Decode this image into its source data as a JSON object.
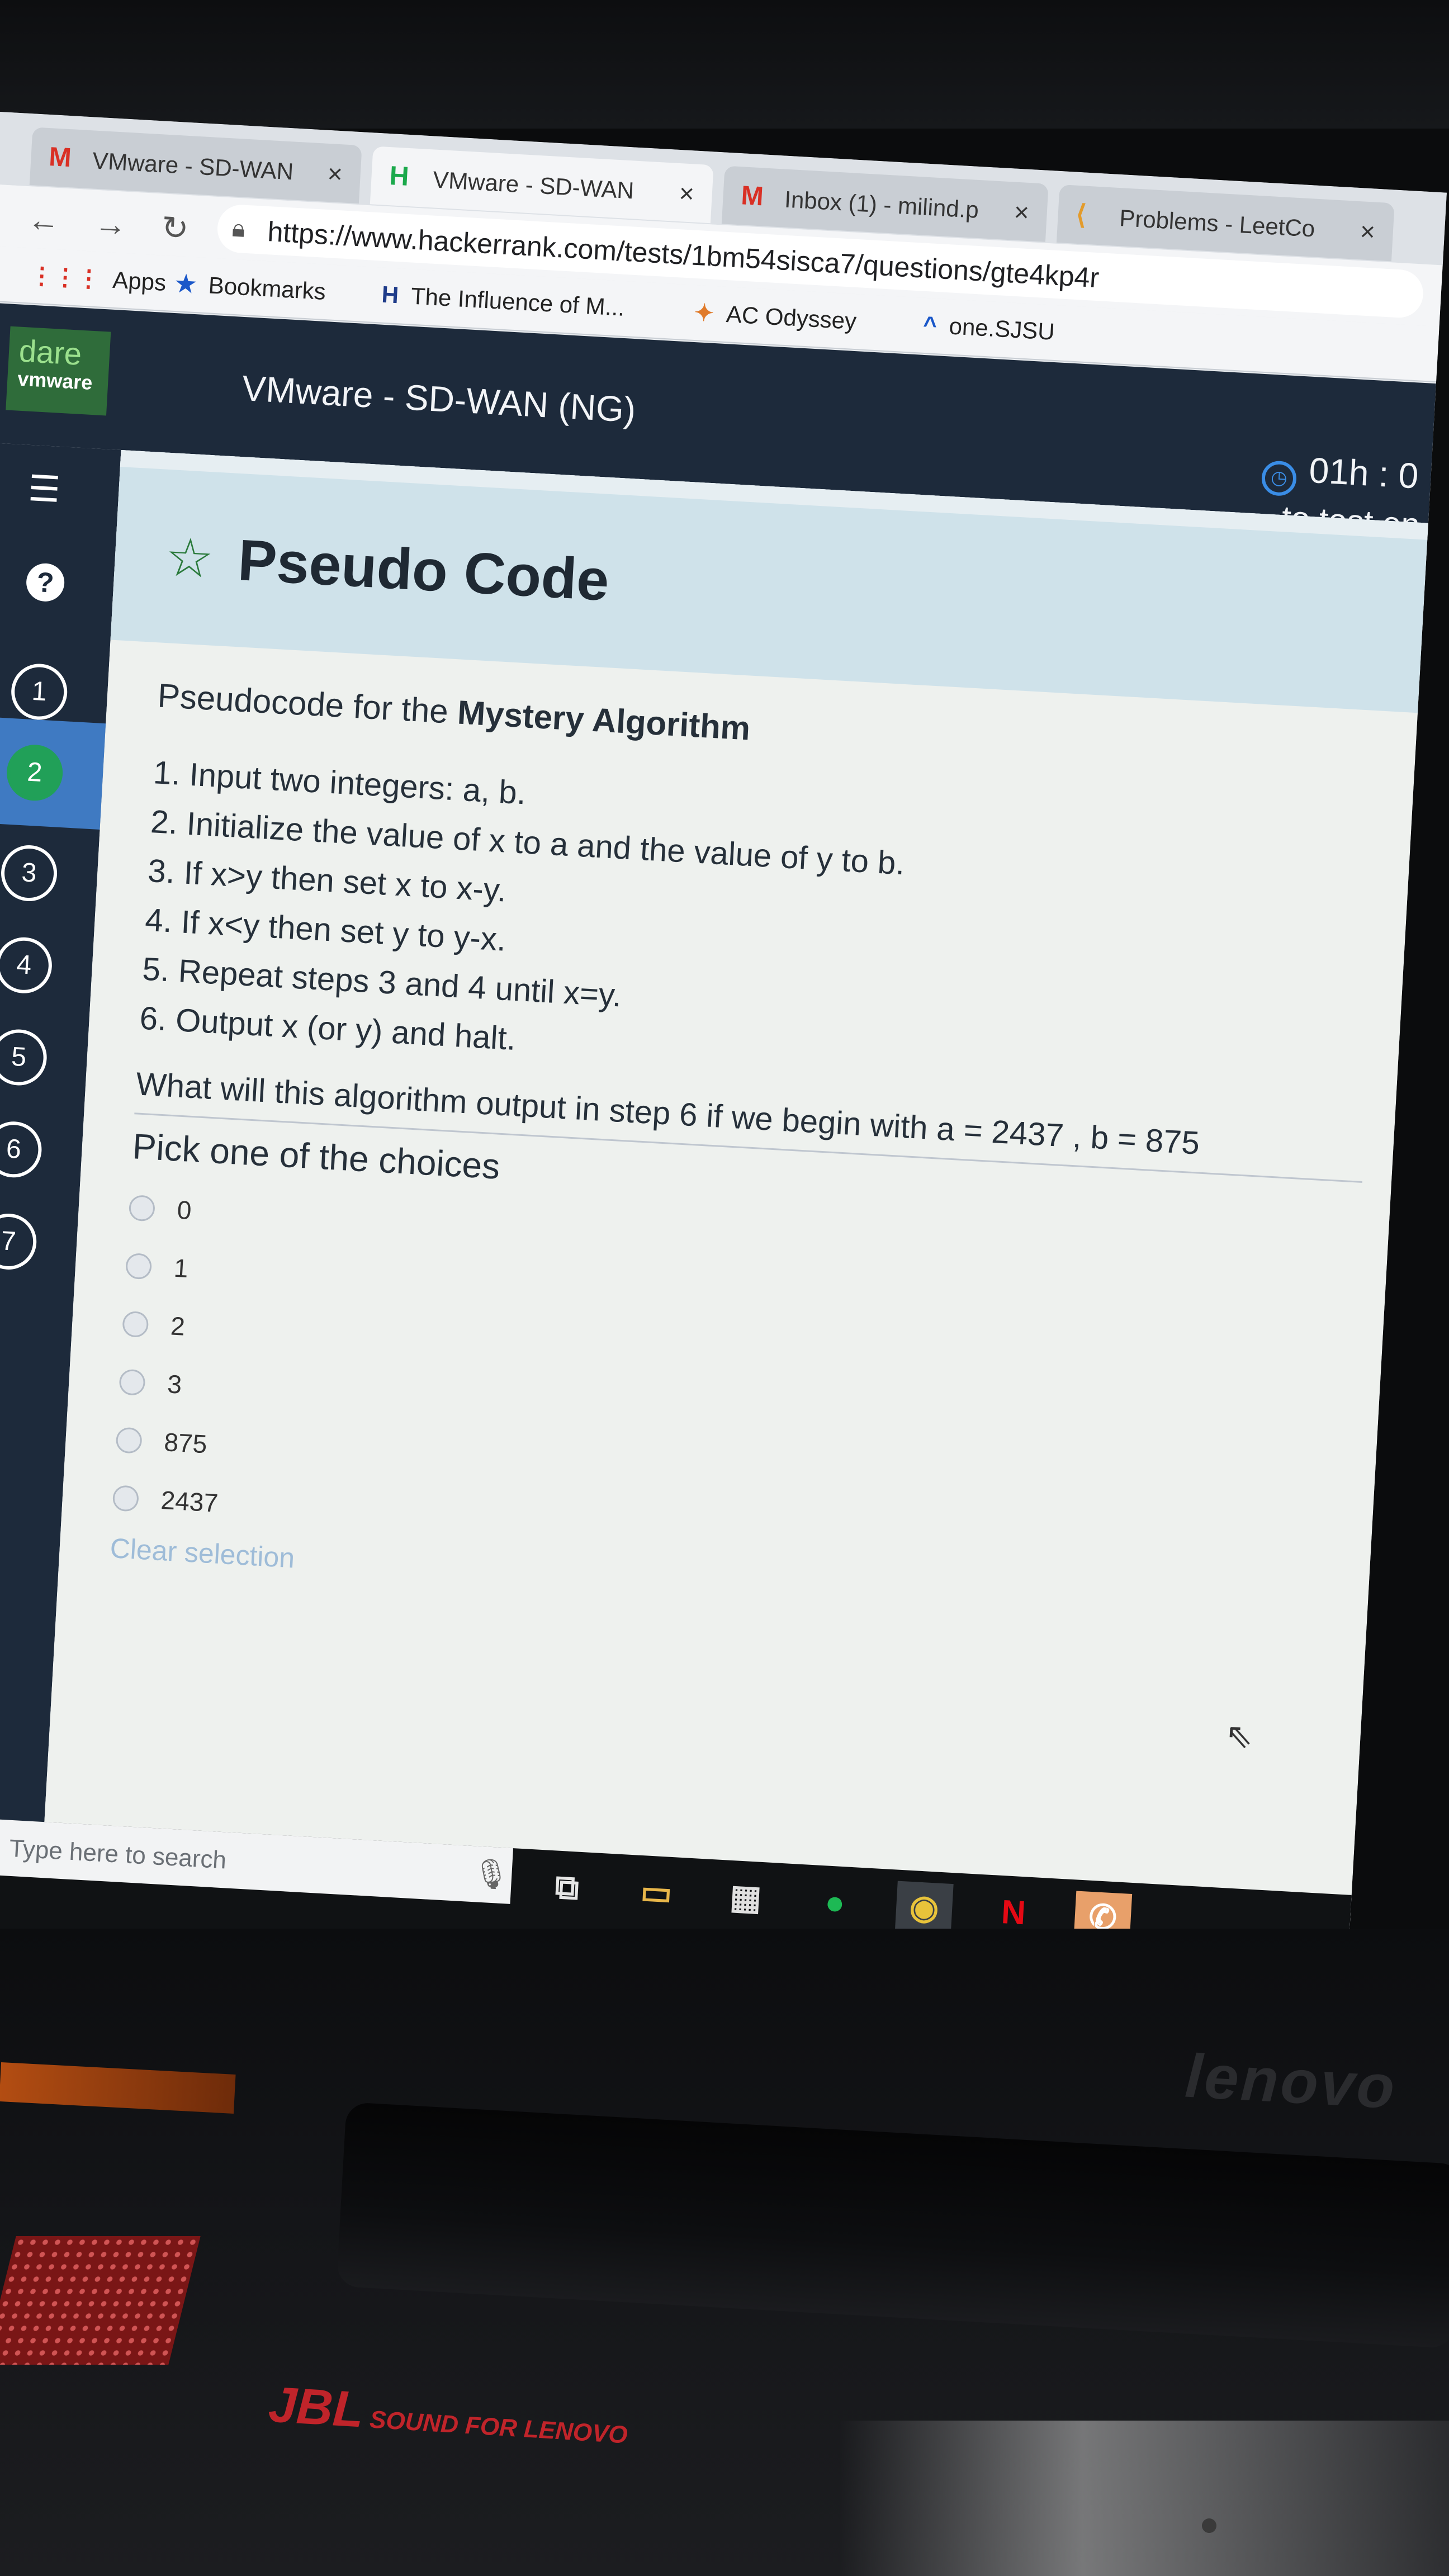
{
  "browser": {
    "tabs": [
      {
        "icon": "M",
        "title": "VMware - SD-WAN",
        "close": "×"
      },
      {
        "icon": "H",
        "title": "VMware - SD-WAN",
        "close": "×"
      },
      {
        "icon": "M",
        "title": "Inbox (1) - milind.p",
        "close": "×"
      },
      {
        "icon": "⟨",
        "title": "Problems - LeetCo",
        "close": "×"
      }
    ],
    "url": "https://www.hackerrank.com/tests/1bm54sisca7/questions/gte4kp4r",
    "bookmarks": [
      {
        "icon": "⋮⋮⋮",
        "label": "Apps"
      },
      {
        "icon": "★",
        "label": "Bookmarks"
      },
      {
        "icon": "H",
        "label": "The Influence of M..."
      },
      {
        "icon": "✦",
        "label": "AC Odyssey"
      },
      {
        "icon": "^",
        "label": "one.SJSU"
      }
    ]
  },
  "header": {
    "logo_top": "dare",
    "logo_bottom": "vmware",
    "test_title": "VMware - SD-WAN (NG)",
    "timer": "01h : 0",
    "timer_sub": "to test en"
  },
  "sidebar": {
    "help": "?",
    "questions": [
      "1",
      "2",
      "3",
      "4",
      "5",
      "6",
      "7"
    ],
    "active_question": "2"
  },
  "question": {
    "title": "Pseudo Code",
    "intro_prefix": "Pseudocode for the ",
    "intro_bold": "Mystery Algorithm",
    "steps": [
      "1. Input two integers: a, b.",
      "2. Initialize the value of x to a and the value of y to b.",
      "3. If x>y then set x to x-y.",
      "4. If x<y then set y to y-x.",
      "5. Repeat steps 3 and 4 until x=y.",
      "6. Output x (or y) and halt."
    ],
    "prompt": "What will this algorithm output in step 6 if we begin with a = 2437 , b = 875",
    "pick_label": "Pick one of the choices",
    "choices": [
      "0",
      "1",
      "2",
      "3",
      "875",
      "2437"
    ],
    "clear_selection": "Clear selection"
  },
  "taskbar": {
    "search_placeholder": "Type here to search",
    "netflix_letter": "N"
  },
  "hardware": {
    "brand": "lenovo",
    "audio_brand": "JBL",
    "audio_tagline": "SOUND FOR LENOVO"
  }
}
